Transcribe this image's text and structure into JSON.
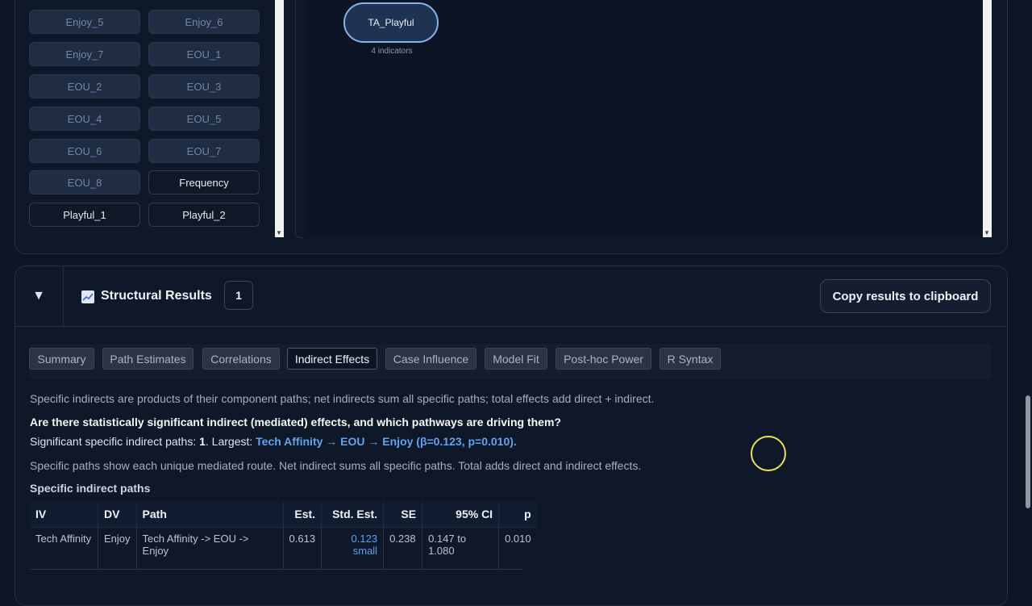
{
  "indicators": {
    "items": [
      {
        "label": "Enjoy_5",
        "state": "dim"
      },
      {
        "label": "Enjoy_6",
        "state": "dim"
      },
      {
        "label": "Enjoy_7",
        "state": "dim"
      },
      {
        "label": "EOU_1",
        "state": "dim"
      },
      {
        "label": "EOU_2",
        "state": "dim"
      },
      {
        "label": "EOU_3",
        "state": "dim"
      },
      {
        "label": "EOU_4",
        "state": "dim"
      },
      {
        "label": "EOU_5",
        "state": "dim"
      },
      {
        "label": "EOU_6",
        "state": "dim"
      },
      {
        "label": "EOU_7",
        "state": "dim"
      },
      {
        "label": "EOU_8",
        "state": "dim"
      },
      {
        "label": "Frequency",
        "state": "active"
      },
      {
        "label": "Playful_1",
        "state": "active"
      },
      {
        "label": "Playful_2",
        "state": "active"
      }
    ]
  },
  "canvas": {
    "node_label": "TA_Playful",
    "node_sub": "4 indicators"
  },
  "results": {
    "title": "Structural Results",
    "badge": "1",
    "copy_label": "Copy results to clipboard",
    "collapse_icon": "▼",
    "icon": "chart-icon"
  },
  "tabs": [
    {
      "label": "Summary",
      "active": false
    },
    {
      "label": "Path Estimates",
      "active": false
    },
    {
      "label": "Correlations",
      "active": false
    },
    {
      "label": "Indirect Effects",
      "active": true
    },
    {
      "label": "Case Influence",
      "active": false
    },
    {
      "label": "Model Fit",
      "active": false
    },
    {
      "label": "Post-hoc Power",
      "active": false
    },
    {
      "label": "R Syntax",
      "active": false
    }
  ],
  "content": {
    "intro": "Specific indirects are products of their component paths; net indirects sum all specific paths; total effects add direct + indirect.",
    "question": "Are there statistically significant indirect (mediated) effects, and which pathways are driving them?",
    "sig_prefix": "Significant specific indirect paths: ",
    "sig_count": "1",
    "sig_mid": ". Largest: ",
    "sig_highlight": "Tech Affinity → EOU → Enjoy (β=0.123, p=0.010).",
    "explain": "Specific paths show each unique mediated route. Net indirect sums all specific paths. Total adds direct and indirect effects.",
    "section_label": "Specific indirect paths"
  },
  "table": {
    "headers": [
      "IV",
      "DV",
      "Path",
      "Est.",
      "Std. Est.",
      "SE",
      "95% CI",
      "p"
    ],
    "rows": [
      {
        "iv": "Tech Affinity",
        "dv": "Enjoy",
        "path": "Tech Affinity -> EOU -> Enjoy",
        "est": "0.613",
        "std_est": "0.123",
        "std_label": "small",
        "se": "0.238",
        "ci": "0.147 to 1.080",
        "p": "0.010"
      }
    ]
  },
  "colors": {
    "background": "#0e1626",
    "accent": "#62a3f0",
    "cursor_ring": "#e8e25a"
  }
}
